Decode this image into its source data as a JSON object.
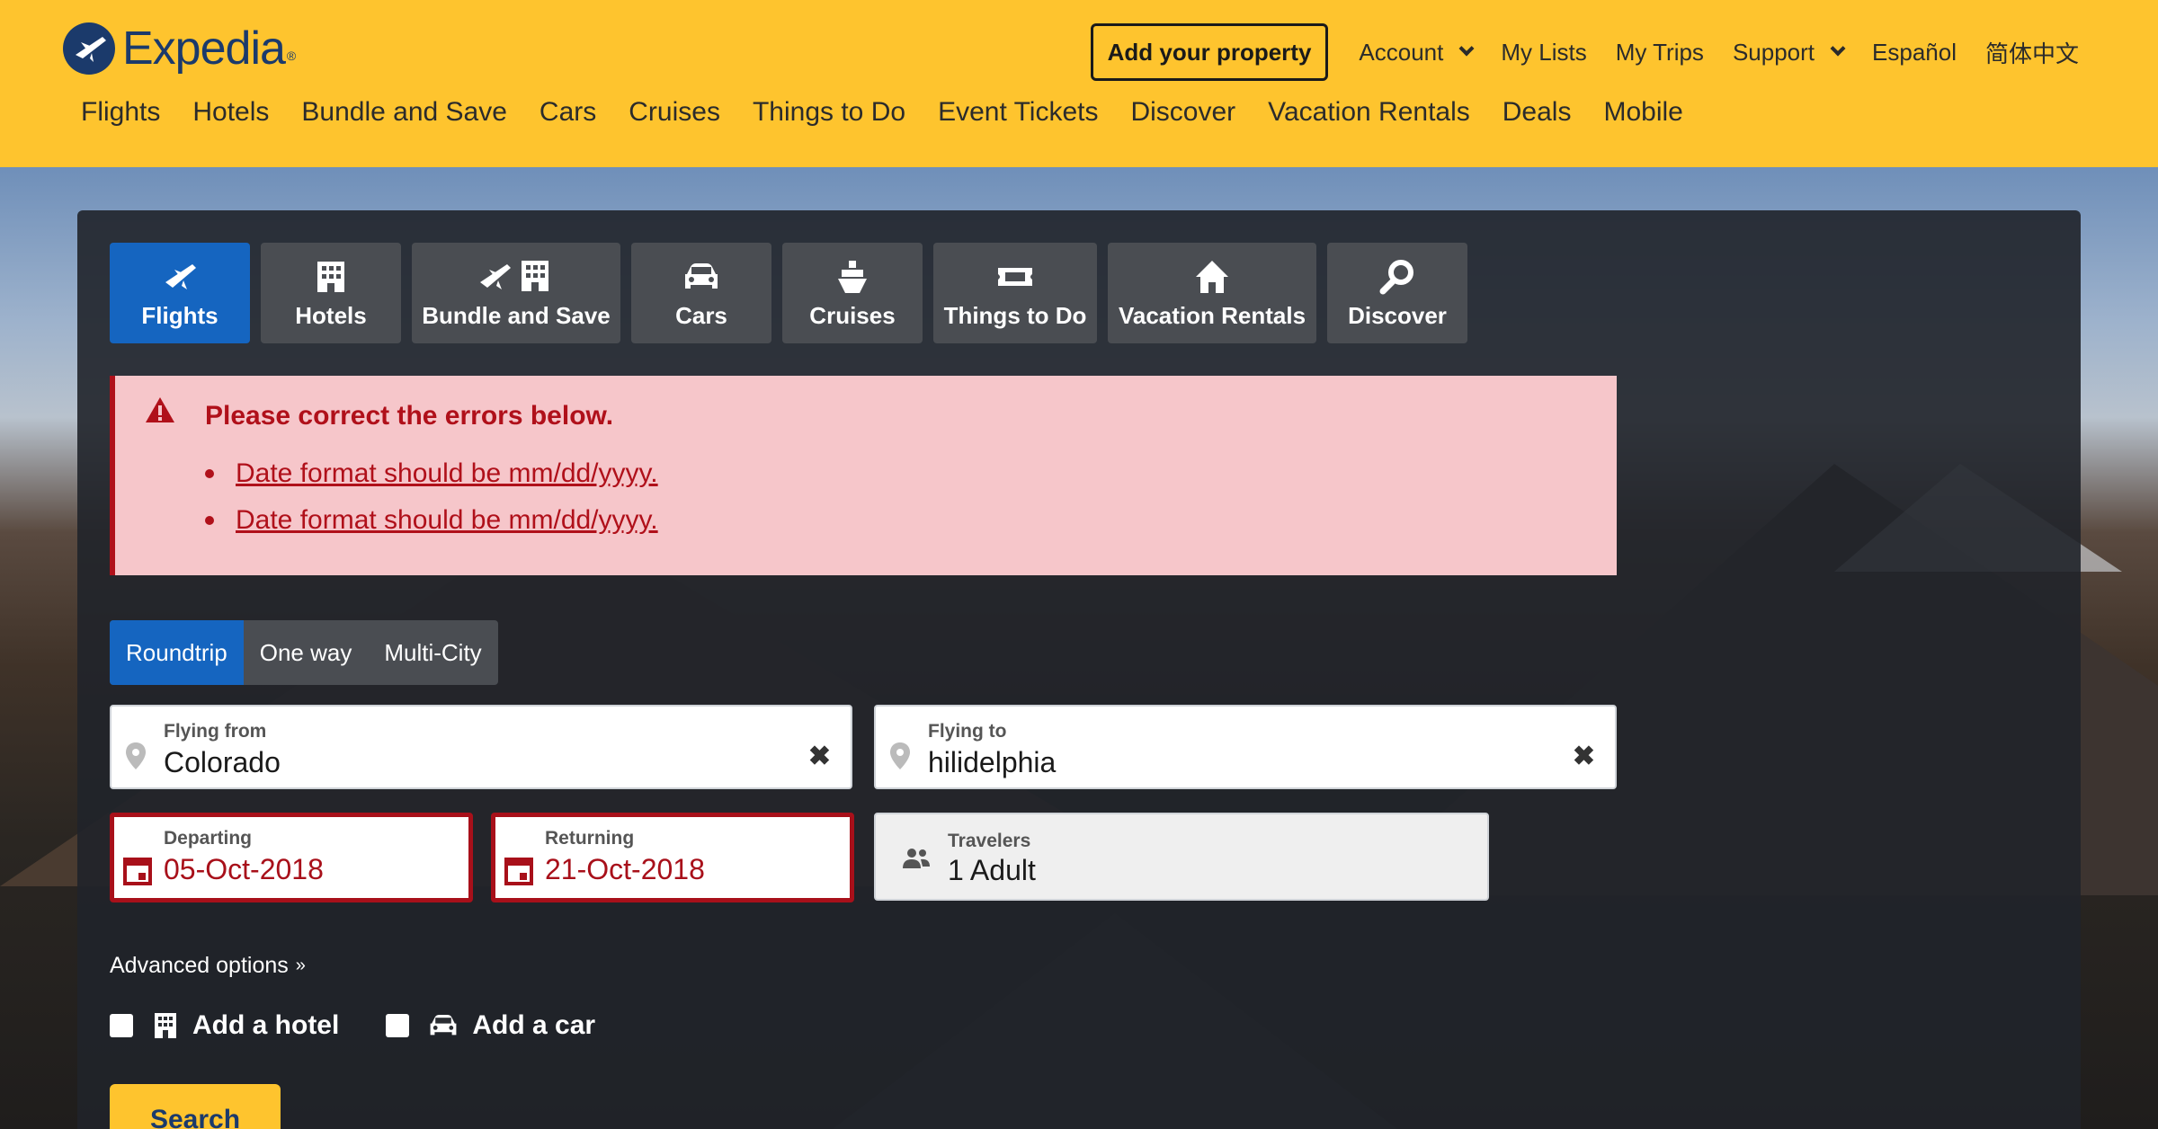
{
  "brand": {
    "name": "Expedia",
    "reg": "®"
  },
  "header": {
    "add_property": "Add your property",
    "top_links": [
      {
        "label": "Account",
        "dropdown": true
      },
      {
        "label": "My Lists",
        "dropdown": false
      },
      {
        "label": "My Trips",
        "dropdown": false
      },
      {
        "label": "Support",
        "dropdown": true
      },
      {
        "label": "Español",
        "dropdown": false
      },
      {
        "label": "简体中文",
        "dropdown": false
      }
    ],
    "nav": [
      "Flights",
      "Hotels",
      "Bundle and Save",
      "Cars",
      "Cruises",
      "Things to Do",
      "Event Tickets",
      "Discover",
      "Vacation Rentals",
      "Deals",
      "Mobile"
    ]
  },
  "tabs": [
    {
      "label": "Flights",
      "icon": "plane-icon",
      "active": true
    },
    {
      "label": "Hotels",
      "icon": "building-icon",
      "active": false
    },
    {
      "label": "Bundle and Save",
      "icon": "plane-building-icon",
      "active": false
    },
    {
      "label": "Cars",
      "icon": "car-icon",
      "active": false
    },
    {
      "label": "Cruises",
      "icon": "ship-icon",
      "active": false
    },
    {
      "label": "Things to Do",
      "icon": "ticket-icon",
      "active": false
    },
    {
      "label": "Vacation Rentals",
      "icon": "house-icon",
      "active": false
    },
    {
      "label": "Discover",
      "icon": "magnifier-icon",
      "active": false
    }
  ],
  "errors": {
    "title": "Please correct the errors below.",
    "items": [
      "Date format should be mm/dd/yyyy.",
      "Date format should be mm/dd/yyyy."
    ]
  },
  "trip_types": [
    {
      "label": "Roundtrip",
      "active": true
    },
    {
      "label": "One way",
      "active": false
    },
    {
      "label": "Multi-City",
      "active": false
    }
  ],
  "form": {
    "from": {
      "label": "Flying from",
      "value": "Colorado"
    },
    "to": {
      "label": "Flying to",
      "value": "hilidelphia"
    },
    "depart": {
      "label": "Departing",
      "value": "05-Oct-2018"
    },
    "return": {
      "label": "Returning",
      "value": "21-Oct-2018"
    },
    "travelers": {
      "label": "Travelers",
      "value": "1 Adult"
    }
  },
  "advanced": "Advanced options",
  "addons": {
    "hotel": "Add a hotel",
    "car": "Add a car"
  },
  "search": "Search",
  "colors": {
    "header": "#fec42e",
    "active_tab": "#1565c0",
    "error": "#b0101a",
    "error_bg": "#f6c6ca"
  }
}
